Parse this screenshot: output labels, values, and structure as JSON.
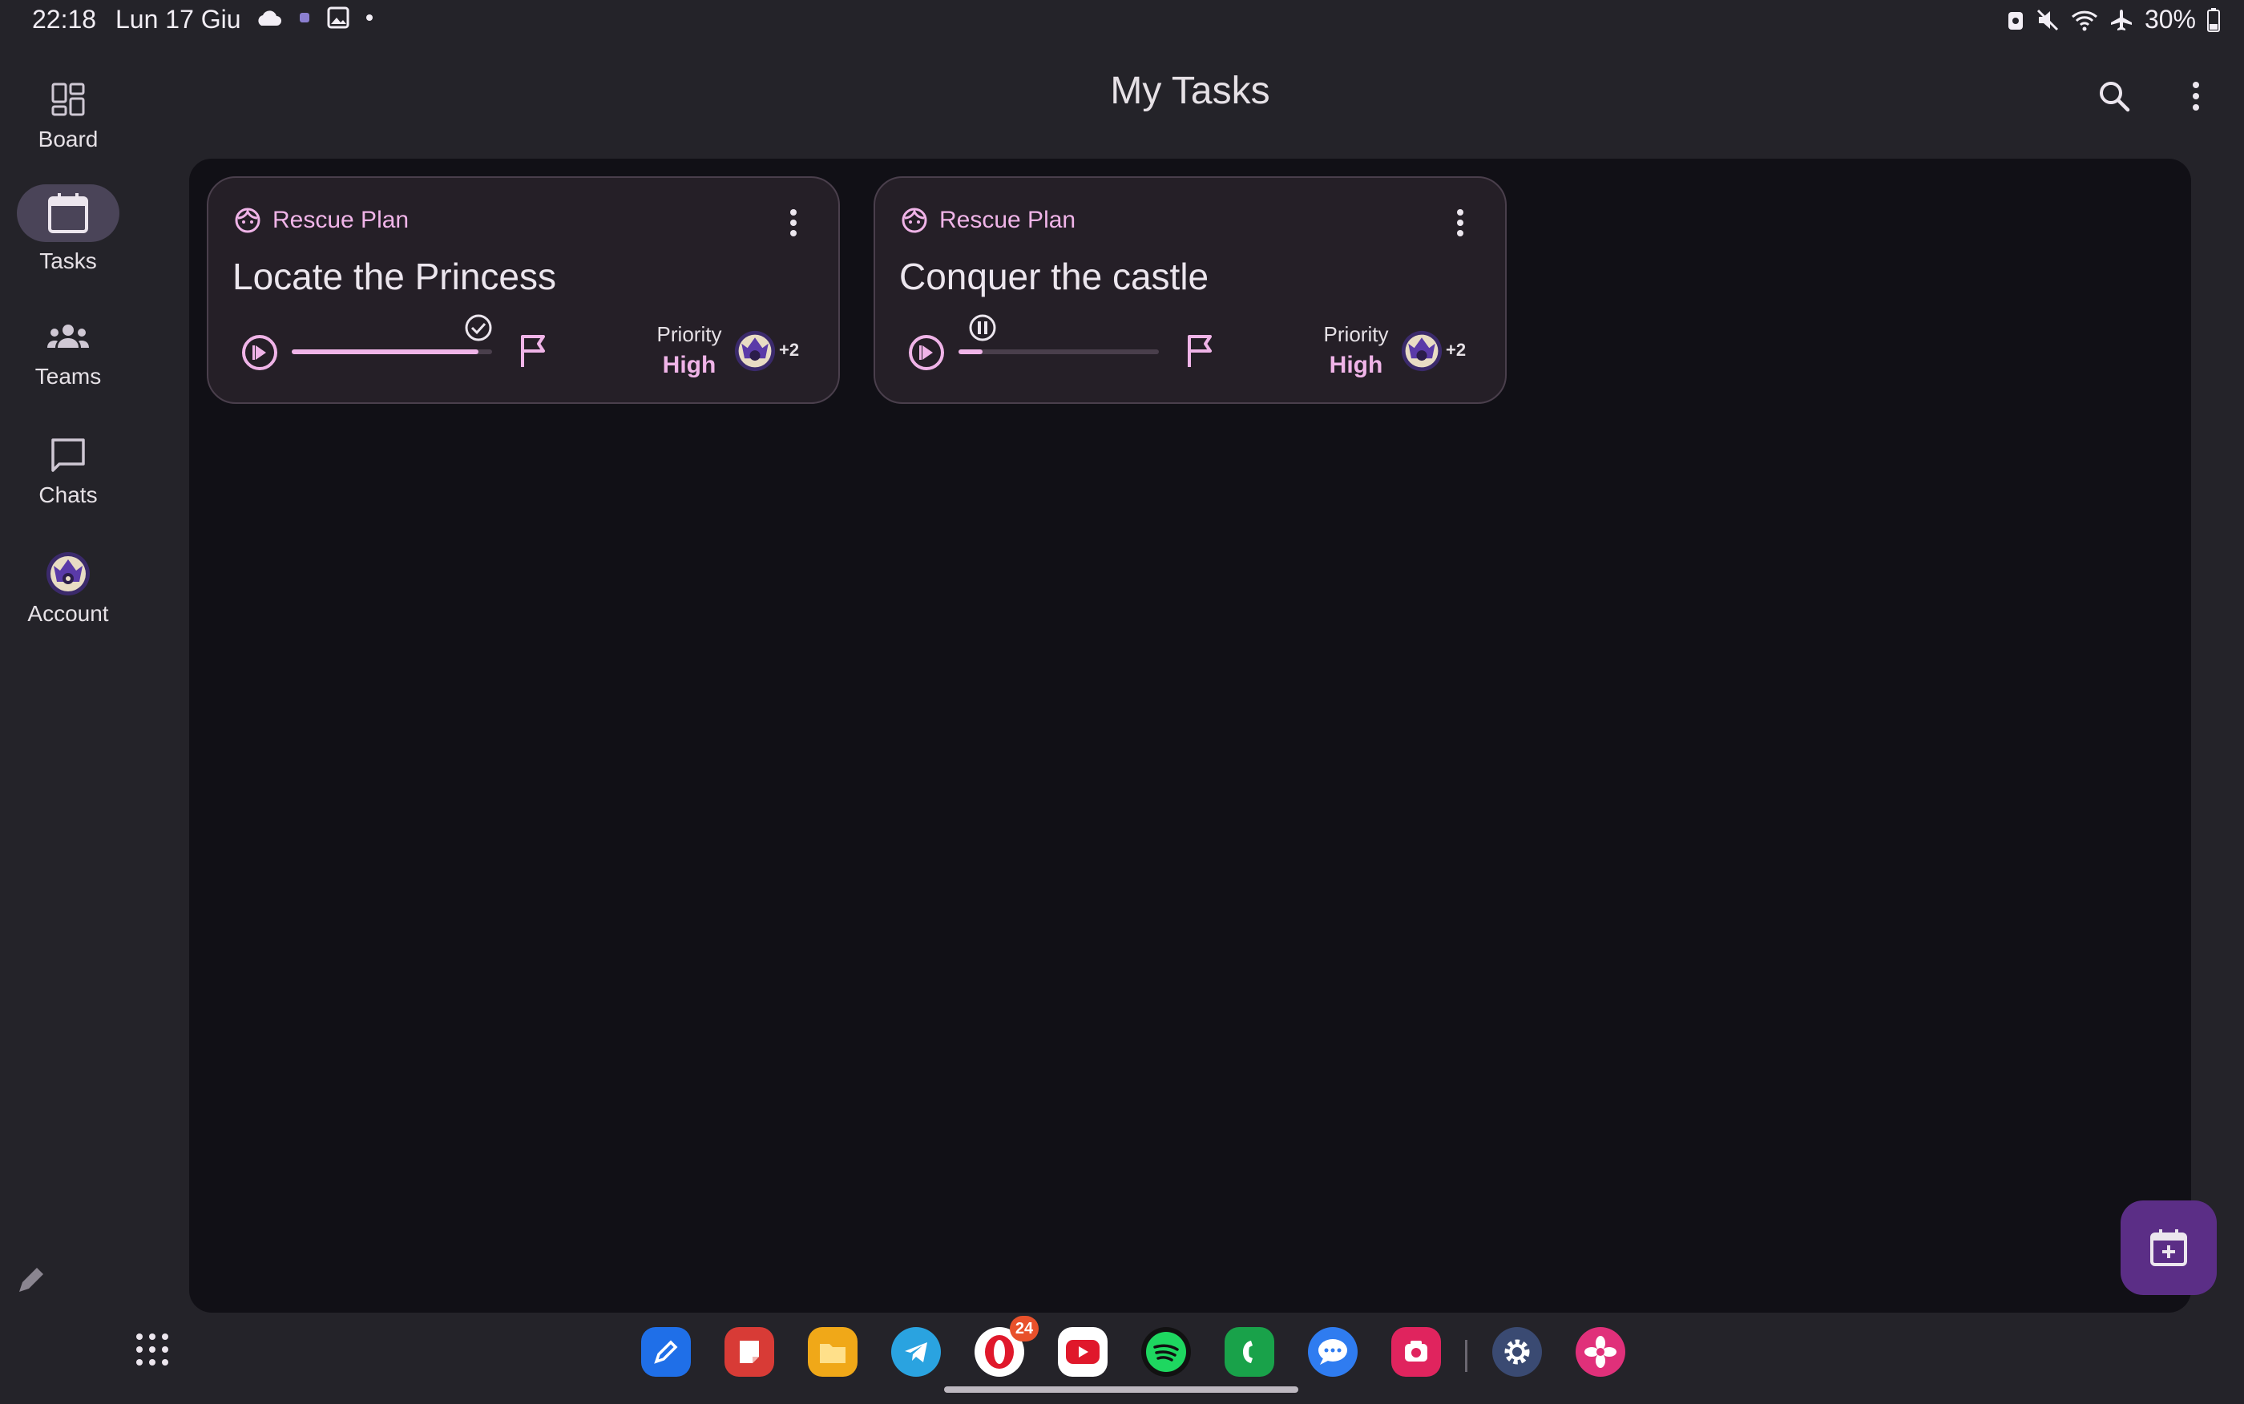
{
  "status_bar": {
    "time": "22:18",
    "date": "Lun 17 Giu",
    "battery": "30%"
  },
  "nav_rail": {
    "items": [
      {
        "label": "Board",
        "icon": "board-grid-icon",
        "active": false
      },
      {
        "label": "Tasks",
        "icon": "calendar-icon",
        "active": true
      },
      {
        "label": "Teams",
        "icon": "groups-icon",
        "active": false
      },
      {
        "label": "Chats",
        "icon": "chat-bubble-icon",
        "active": false
      },
      {
        "label": "Account",
        "icon": "avatar",
        "active": false
      }
    ]
  },
  "top_bar": {
    "title": "My Tasks",
    "actions": [
      "search-icon",
      "more-vert-icon"
    ]
  },
  "tasks": [
    {
      "project": "Rescue Plan",
      "title": "Locate the Princess",
      "progress": 0.93,
      "progress_state": "completed",
      "priority_label": "Priority",
      "priority_value": "High",
      "extra_members": "+2"
    },
    {
      "project": "Rescue Plan",
      "title": "Conquer the castle",
      "progress": 0.12,
      "progress_state": "paused",
      "priority_label": "Priority",
      "priority_value": "High",
      "extra_members": "+2"
    }
  ],
  "dock": {
    "apps": [
      "pen-app",
      "notes-app",
      "files-app",
      "telegram-app",
      "opera-app",
      "youtube-app",
      "spotify-app",
      "phone-app",
      "messages-app",
      "camera-app",
      "settings-app",
      "flower-app"
    ],
    "opera_badge": "24"
  },
  "colors": {
    "accent": "#f0b4e8",
    "fab": "#5b2e86",
    "panel": "#111016",
    "card": "#251f27"
  }
}
